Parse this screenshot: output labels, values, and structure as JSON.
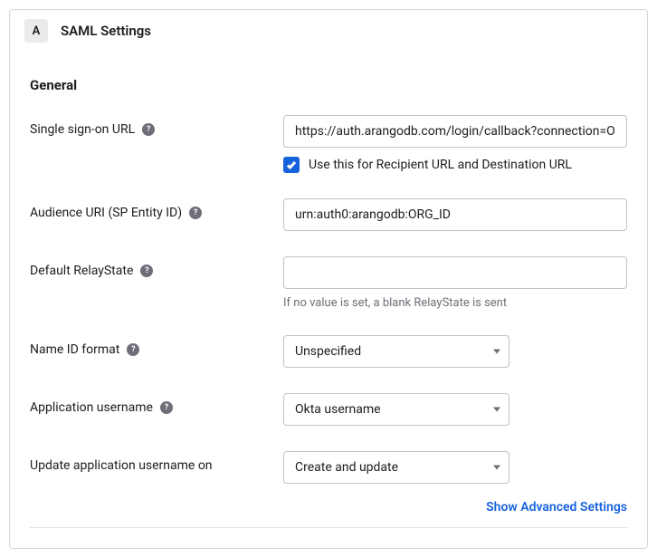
{
  "header": {
    "step": "A",
    "title": "SAML Settings"
  },
  "section_heading": "General",
  "fields": {
    "sso_url": {
      "label": "Single sign-on URL",
      "value": "https://auth.arangodb.com/login/callback?connection=O",
      "checkbox_label": "Use this for Recipient URL and Destination URL"
    },
    "audience_uri": {
      "label": "Audience URI (SP Entity ID)",
      "value": "urn:auth0:arangodb:ORG_ID"
    },
    "relay_state": {
      "label": "Default RelayState",
      "value": "",
      "helper": "If no value is set, a blank RelayState is sent"
    },
    "name_id_format": {
      "label": "Name ID format",
      "value": "Unspecified"
    },
    "app_username": {
      "label": "Application username",
      "value": "Okta username"
    },
    "update_username_on": {
      "label": "Update application username on",
      "value": "Create and update"
    }
  },
  "advanced_link": "Show Advanced Settings"
}
